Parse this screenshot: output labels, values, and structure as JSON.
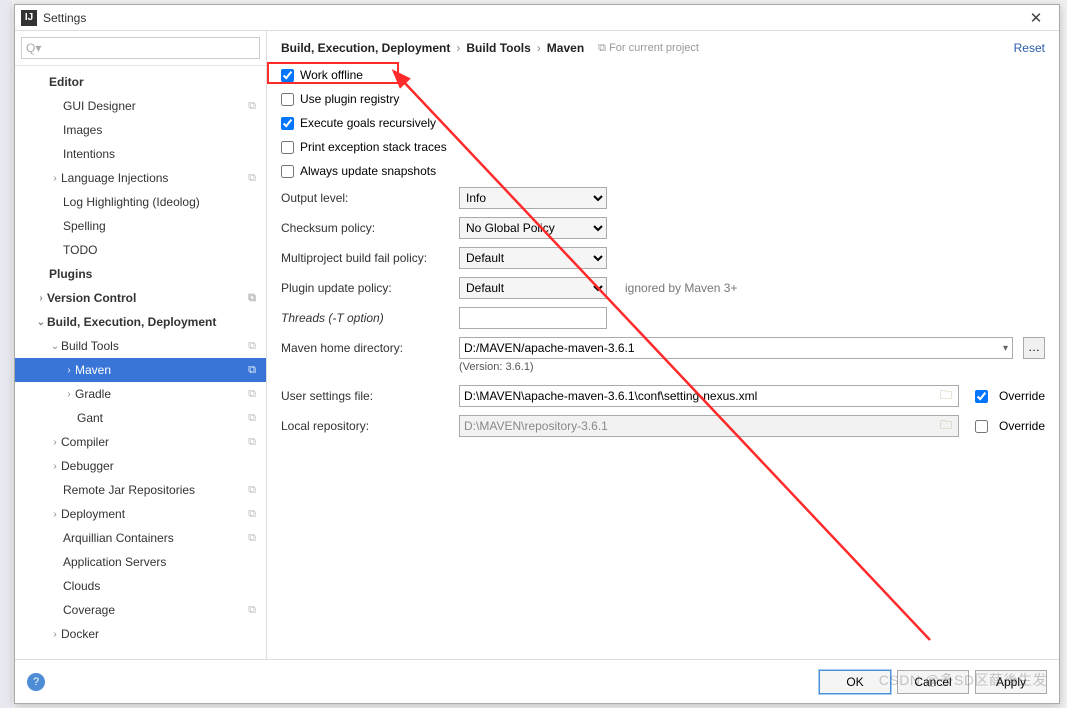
{
  "window": {
    "title": "Settings",
    "close": "✕"
  },
  "search": {
    "placeholder": "Q▾"
  },
  "tree": {
    "editor": "Editor",
    "gui_designer": "GUI Designer",
    "images": "Images",
    "intentions": "Intentions",
    "lang_inj": "Language Injections",
    "log_hl": "Log Highlighting (Ideolog)",
    "spelling": "Spelling",
    "todo": "TODO",
    "plugins": "Plugins",
    "vcs": "Version Control",
    "bed": "Build, Execution, Deployment",
    "build_tools": "Build Tools",
    "maven": "Maven",
    "gradle": "Gradle",
    "gant": "Gant",
    "compiler": "Compiler",
    "debugger": "Debugger",
    "remote_jar": "Remote Jar Repositories",
    "deployment": "Deployment",
    "arquillian": "Arquillian Containers",
    "app_servers": "Application Servers",
    "clouds": "Clouds",
    "coverage": "Coverage",
    "docker": "Docker"
  },
  "header": {
    "bc1": "Build, Execution, Deployment",
    "bc2": "Build Tools",
    "bc3": "Maven",
    "hint": "For current project",
    "reset": "Reset"
  },
  "checks": {
    "work_offline": "Work offline",
    "plugin_registry": "Use plugin registry",
    "exec_goals": "Execute goals recursively",
    "print_ex": "Print exception stack traces",
    "update_snap": "Always update snapshots"
  },
  "fields": {
    "output_level": "Output level:",
    "output_level_val": "Info",
    "checksum": "Checksum policy:",
    "checksum_val": "No Global Policy",
    "multiproject": "Multiproject build fail policy:",
    "multiproject_val": "Default",
    "plugin_update": "Plugin update policy:",
    "plugin_update_val": "Default",
    "plugin_update_hint": "ignored by Maven 3+",
    "threads": "Threads (-T option)",
    "maven_home": "Maven home directory:",
    "maven_home_val": "D:/MAVEN/apache-maven-3.6.1",
    "version": "(Version: 3.6.1)",
    "user_settings": "User settings file:",
    "user_settings_val": "D:\\MAVEN\\apache-maven-3.6.1\\conf\\setting-nexus.xml",
    "local_repo": "Local repository:",
    "local_repo_val": "D:\\MAVEN\\repository-3.6.1",
    "override": "Override"
  },
  "footer": {
    "ok": "OK",
    "cancel": "Cancel",
    "apply": "Apply"
  },
  "watermark": "CSDN @多SD区薛後生发"
}
